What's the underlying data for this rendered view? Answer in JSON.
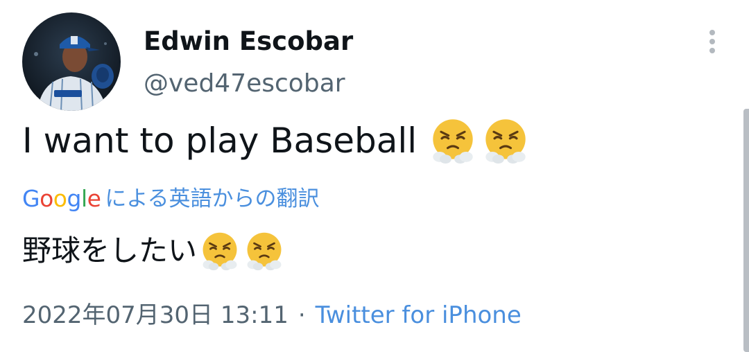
{
  "tweet": {
    "author": {
      "display_name": "Edwin Escobar",
      "handle": "@ved47escobar",
      "avatar_icon": "baseball-player-avatar"
    },
    "more_icon": "more-vertical-icon",
    "text": "I want to play Baseball",
    "text_emojis": [
      "face-with-steam-from-nose",
      "face-with-steam-from-nose"
    ],
    "translation": {
      "provider_logo": {
        "letters": [
          "G",
          "o",
          "o",
          "g",
          "l",
          "e"
        ],
        "colors": [
          "#4285F4",
          "#EA4335",
          "#FBBC05",
          "#4285F4",
          "#34A853",
          "#EA4335"
        ]
      },
      "label": "による英語からの翻訳",
      "translated_text": "野球をしたい",
      "translated_emojis": [
        "face-with-steam-from-nose",
        "face-with-steam-from-nose"
      ]
    },
    "timestamp": "2022年07月30日 13:11",
    "separator": "·",
    "source": "Twitter for iPhone"
  },
  "colors": {
    "text_primary": "#0f1419",
    "text_secondary": "#536471",
    "link": "#4a8fde",
    "emoji_face": "#f5c33b"
  }
}
